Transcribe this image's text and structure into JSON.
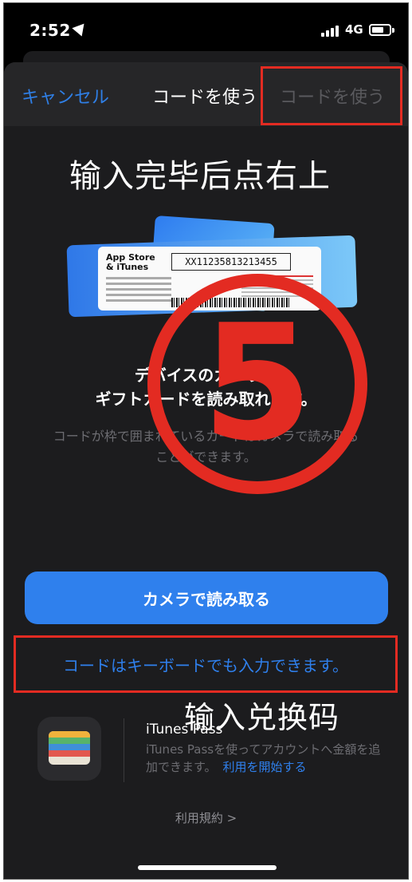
{
  "status_bar": {
    "time": "2:52",
    "network": "4G",
    "icons": [
      "location-arrow-icon",
      "signal-bars-icon",
      "battery-icon"
    ]
  },
  "nav": {
    "cancel_label": "キャンセル",
    "title": "コードを使う",
    "redeem_label": "コードを使う"
  },
  "annotations": {
    "top_text": "输入完毕后点右上",
    "step_number": "5",
    "bottom_text": "输入兑换码",
    "highlight_color": "#e32b22"
  },
  "gift_card": {
    "brand_line1": "App Store",
    "brand_line2": "& iTunes",
    "code": "XX11235813213455"
  },
  "main": {
    "heading_line1": "デバイスのカメラで",
    "heading_line2": "ギフトカードを読み取れます。",
    "desc_line1": "コードが枠で囲まれているカードはカメラで読み取る",
    "desc_line2": "ことができます。",
    "camera_button": "カメラで読み取る",
    "keyboard_link": "コードはキーボードでも入力できます。"
  },
  "pass": {
    "title": "iTunes Pass",
    "desc_line1": "iTunes Passを使ってアカウントへ金額を追",
    "desc_line2": "加できます。",
    "start_link": "利用を開始する",
    "icon": "wallet-icon"
  },
  "footer": {
    "terms": "利用規約 >"
  },
  "colors": {
    "accent": "#2f80ed",
    "background": "#1c1c1e",
    "annotation_red": "#e32b22"
  }
}
